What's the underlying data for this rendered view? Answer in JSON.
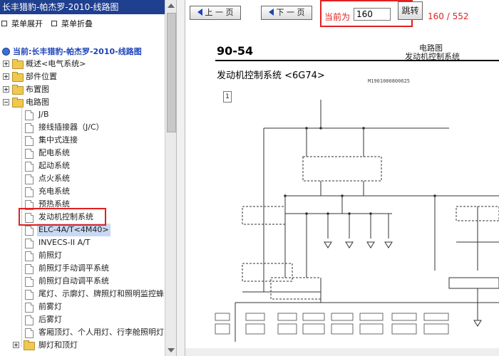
{
  "left_panel": {
    "title": "长丰猎豹-帕杰罗-2010-线路图",
    "expand_label": "菜单展开",
    "collapse_label": "菜单折叠",
    "root_label": "当前:长丰猎豹-帕杰罗-2010-线路图",
    "folders": [
      "概述<电气系统>",
      "部件位置",
      "布置图",
      "电路图"
    ],
    "children": [
      "J/B",
      "接线插接器（J/C）",
      "集中式连接",
      "配电系统",
      "起动系统",
      "点火系统",
      "充电系统",
      "预热系统",
      "发动机控制系统",
      "ELC-4A/T<4M40>",
      "INVECS-II A/T",
      "前照灯",
      "前照灯手动调平系统",
      "前照灯自动调平系统",
      "尾灯、示廓灯、牌照灯和照明监控蜂",
      "前雾灯",
      "后雾灯",
      "客厢顶灯、个人用灯、行李舱照明灯"
    ],
    "last_folder": "脚灯和顶灯"
  },
  "toolbar": {
    "prev_label": "上 一 页",
    "next_label": "下 一 页",
    "current_label": "当前为",
    "current_page": "160",
    "jump_label": "跳转",
    "page_count": "160 / 552"
  },
  "document": {
    "section_number": "90-54",
    "category": "电路图",
    "category_sub": "发动机控制系统",
    "subtitle": "发动机控制系统 <6G74>",
    "doc_code": "M1901000800625",
    "page_marker": "1"
  },
  "colors": {
    "title_bar": "#1f3f8f",
    "highlight": "#e02020",
    "selected_bg": "#c9d9f2"
  }
}
